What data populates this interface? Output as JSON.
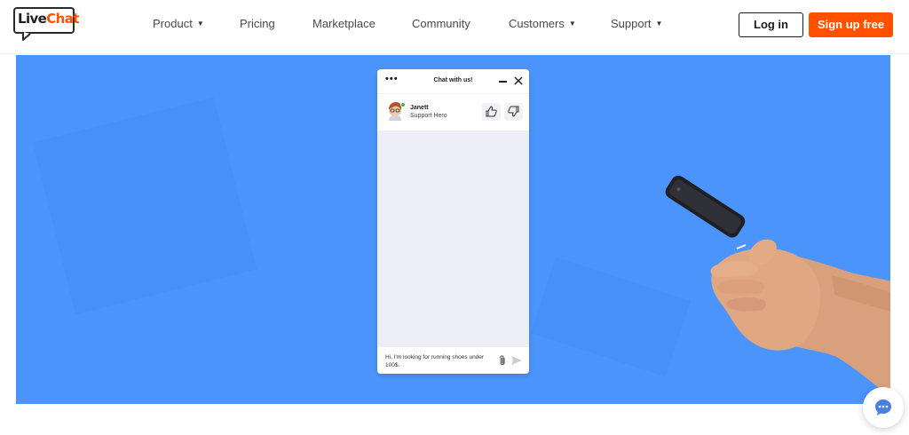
{
  "brand": {
    "logo_prefix": "Live",
    "logo_suffix": "Chat",
    "accent_color": "#ff5100",
    "hero_color": "#4a94fb"
  },
  "nav": {
    "items": [
      {
        "label": "Product",
        "has_dropdown": true
      },
      {
        "label": "Pricing",
        "has_dropdown": false
      },
      {
        "label": "Marketplace",
        "has_dropdown": false
      },
      {
        "label": "Community",
        "has_dropdown": false
      },
      {
        "label": "Customers",
        "has_dropdown": true
      },
      {
        "label": "Support",
        "has_dropdown": true
      }
    ],
    "caret_icon": "▼"
  },
  "header": {
    "login_label": "Log in",
    "signup_label": "Sign up free"
  },
  "widget": {
    "title": "Chat with us!",
    "menu_icon": "•••",
    "agent_name": "Janett",
    "agent_role": "Support Hero",
    "agent_status_color": "#25c14b",
    "input_text": "Hi, I'm looking for running shoes under 100$."
  },
  "icons": {
    "minimize": "minimize-icon",
    "close": "close-icon",
    "thumb_up": "thumbs-up-icon",
    "thumb_down": "thumbs-down-icon",
    "attach": "paperclip-icon",
    "send": "send-icon",
    "fab": "chat-bubble-icon"
  }
}
